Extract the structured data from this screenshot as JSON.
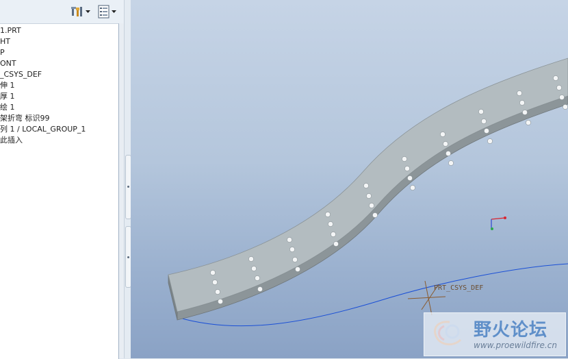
{
  "toolbar": {
    "settings_icon": "settings-tools-icon",
    "show_icon": "tree-filter-icon"
  },
  "model_tree": {
    "items": [
      {
        "label": "1.PRT"
      },
      {
        "label": "HT"
      },
      {
        "label": "P"
      },
      {
        "label": "ONT"
      },
      {
        "label": "_CSYS_DEF"
      },
      {
        "label": "伸 1"
      },
      {
        "label": "厚 1"
      },
      {
        "label": "绘 1"
      },
      {
        "label": "架折弯 标识99"
      },
      {
        "label": "列 1 / LOCAL_GROUP_1"
      },
      {
        "label": "此插入"
      }
    ]
  },
  "viewport": {
    "csys_label": "PRT_CSYS_DEF",
    "colors": {
      "sheet_face": "#b3bcc0",
      "sheet_edge": "#8c9599",
      "curve": "#1a4fd6"
    }
  },
  "watermark": {
    "title": "野火论坛",
    "url": "www.proewildfire.cn"
  }
}
